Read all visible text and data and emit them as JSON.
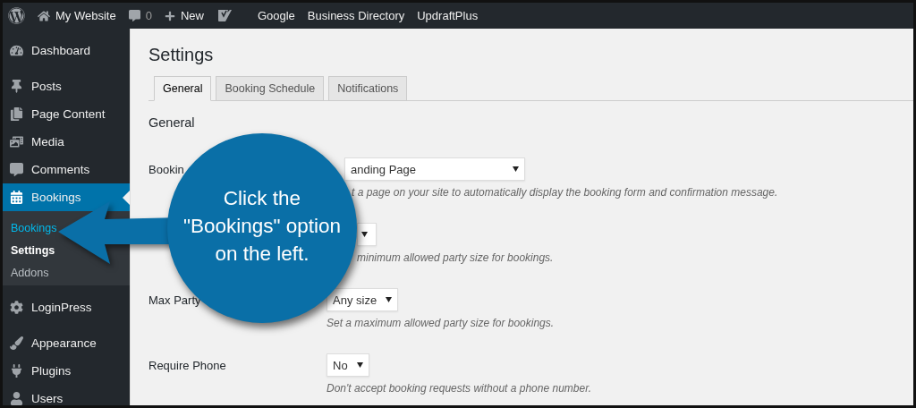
{
  "admin_bar": {
    "items": [
      {
        "kind": "logo"
      },
      {
        "kind": "home",
        "label": "My Website"
      },
      {
        "kind": "comments",
        "label": "0"
      },
      {
        "kind": "new",
        "label": "New"
      },
      {
        "kind": "seo"
      },
      {
        "kind": "link",
        "label": "Google"
      },
      {
        "kind": "link",
        "label": "Business Directory"
      },
      {
        "kind": "link",
        "label": "UpdraftPlus"
      }
    ]
  },
  "sidebar": {
    "groups": [
      [
        {
          "kind": "dashboard",
          "label": "Dashboard",
          "selected": false
        }
      ],
      [
        {
          "kind": "pin",
          "label": "Posts",
          "selected": false
        },
        {
          "kind": "pages",
          "label": "Page Content",
          "selected": false
        },
        {
          "kind": "media",
          "label": "Media",
          "selected": false
        },
        {
          "kind": "comments",
          "label": "Comments",
          "selected": false
        },
        {
          "kind": "calendar",
          "label": "Bookings",
          "selected": true,
          "children": [
            {
              "label": "Bookings",
              "selected": false,
              "hovered": true
            },
            {
              "label": "Settings",
              "selected": true,
              "hovered": false
            },
            {
              "label": "Addons",
              "selected": false,
              "hovered": false
            }
          ]
        }
      ],
      [
        {
          "kind": "gear",
          "label": "LoginPress",
          "selected": false
        }
      ],
      [
        {
          "kind": "brush",
          "label": "Appearance",
          "selected": false
        },
        {
          "kind": "plug",
          "label": "Plugins",
          "selected": false
        },
        {
          "kind": "user",
          "label": "Users",
          "selected": false
        }
      ]
    ]
  },
  "page": {
    "title": "Settings",
    "tabs": [
      {
        "label": "General",
        "selected": true
      },
      {
        "label": "Booking Schedule",
        "selected": false
      },
      {
        "label": "Notifications",
        "selected": false
      }
    ],
    "section_title": "General",
    "rows": [
      {
        "label": "Bookin",
        "select": {
          "value": "anding Page"
        },
        "description": "t a page on your site to automatically display the booking form and confirmation message."
      },
      {
        "select": {},
        "description": "minimum allowed party size for bookings."
      },
      {
        "label": "Max Party",
        "select": {
          "value": "Any size"
        },
        "description": "Set a maximum allowed party size for bookings."
      },
      {
        "label": "Require Phone",
        "select": {
          "value": "No"
        },
        "description": "Don't accept booking requests without a phone number."
      }
    ]
  },
  "callout": {
    "lines": [
      "Click the",
      "\"Bookings\" option",
      "on the left."
    ]
  }
}
